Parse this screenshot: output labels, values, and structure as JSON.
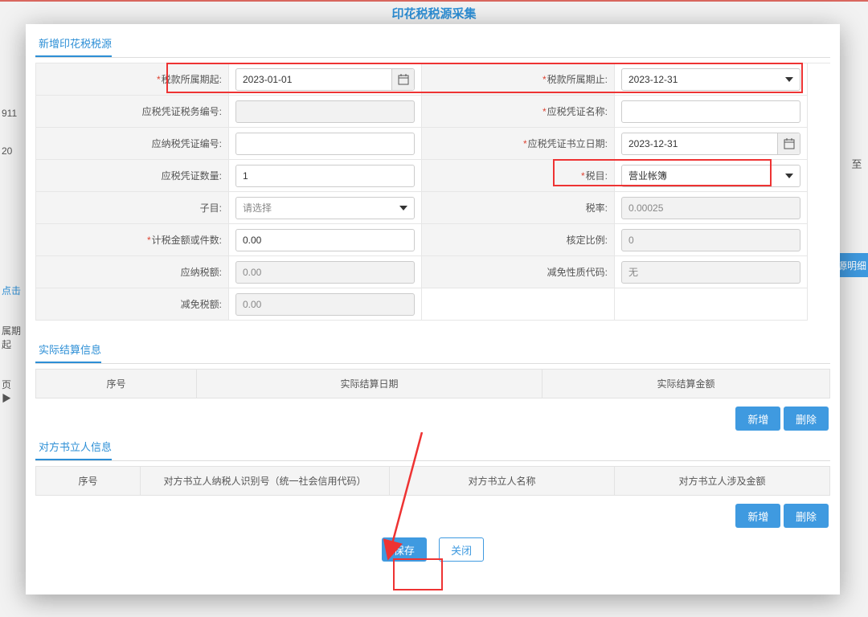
{
  "page_title": "印花税税源采集",
  "bg": {
    "code": "911",
    "year": "20",
    "link": "点击",
    "period_label": "属期起",
    "page_ind": "页 ▶",
    "to_label": "至",
    "tag_right": "源明细"
  },
  "section1": {
    "title": "新增印花税税源",
    "labels": {
      "period_from": "税款所属期起:",
      "period_to": "税款所属期止:",
      "voucher_tax_no": "应税凭证税务编号:",
      "voucher_name": "应税凭证名称:",
      "tax_pay_voucher_no": "应纳税凭证编号:",
      "voucher_date": "应税凭证书立日期:",
      "voucher_qty": "应税凭证数量:",
      "tax_item": "税目:",
      "sub_item": "子目:",
      "tax_rate": "税率:",
      "tax_basis": "计税金额或件数:",
      "assess_ratio": "核定比例:",
      "tax_payable": "应纳税额:",
      "exempt_code": "减免性质代码:",
      "exempt_amount": "减免税额:"
    },
    "values": {
      "period_from": "2023-01-01",
      "period_to": "2023-12-31",
      "voucher_tax_no": "",
      "voucher_name": "",
      "tax_pay_voucher_no": "",
      "voucher_date": "2023-12-31",
      "voucher_qty": "1",
      "tax_item": "营业帐簿",
      "sub_item": "请选择",
      "tax_rate": "0.00025",
      "tax_basis": "0.00",
      "assess_ratio": "0",
      "tax_payable": "0.00",
      "exempt_code": "无",
      "exempt_amount": "0.00"
    }
  },
  "section2": {
    "title": "实际结算信息",
    "cols": [
      "序号",
      "实际结算日期",
      "实际结算金额"
    ]
  },
  "section3": {
    "title": "对方书立人信息",
    "cols": [
      "序号",
      "对方书立人纳税人识别号（统一社会信用代码）",
      "对方书立人名称",
      "对方书立人涉及金额"
    ]
  },
  "buttons": {
    "add": "新增",
    "delete": "删除",
    "save": "保存",
    "close": "关闭"
  }
}
